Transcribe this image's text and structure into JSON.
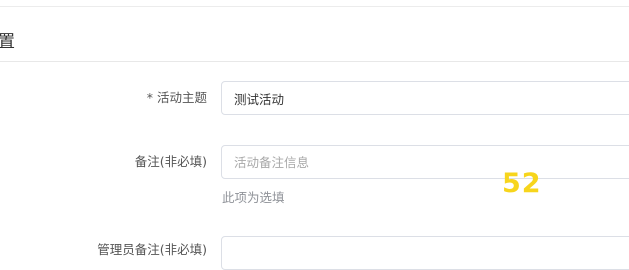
{
  "section": {
    "title": "置"
  },
  "form": {
    "theme": {
      "required_mark": "*",
      "label": "活动主题",
      "value": "测试活动"
    },
    "note": {
      "label": "备注(非必填)",
      "placeholder": "活动备注信息",
      "help": "此项为选填"
    },
    "admin": {
      "label": "管理员备注(非必填)"
    }
  },
  "watermark": {
    "logo_text": "52",
    "color": "#f7d51c"
  },
  "colors": {
    "border": "#dcdfe6",
    "help_text": "#909399",
    "placeholder": "#a8a8a8"
  }
}
